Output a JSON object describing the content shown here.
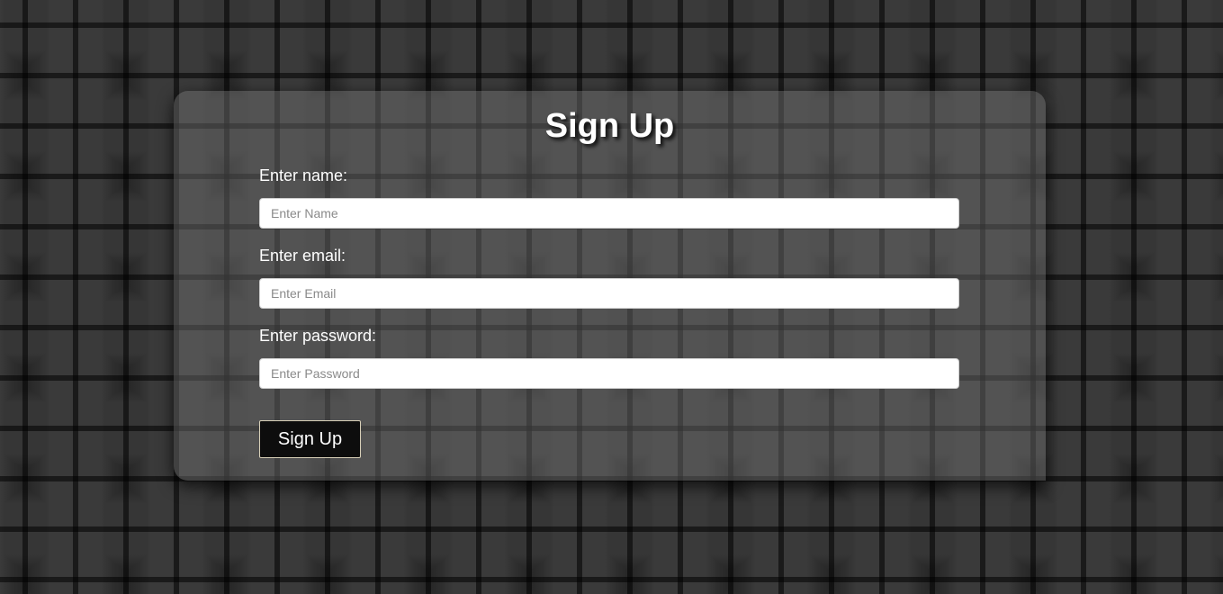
{
  "form": {
    "title": "Sign Up",
    "fields": {
      "name": {
        "label": "Enter name:",
        "placeholder": "Enter Name",
        "value": ""
      },
      "email": {
        "label": "Enter email:",
        "placeholder": "Enter Email",
        "value": ""
      },
      "password": {
        "label": "Enter password:",
        "placeholder": "Enter Password",
        "value": ""
      }
    },
    "submit_label": "Sign Up"
  }
}
